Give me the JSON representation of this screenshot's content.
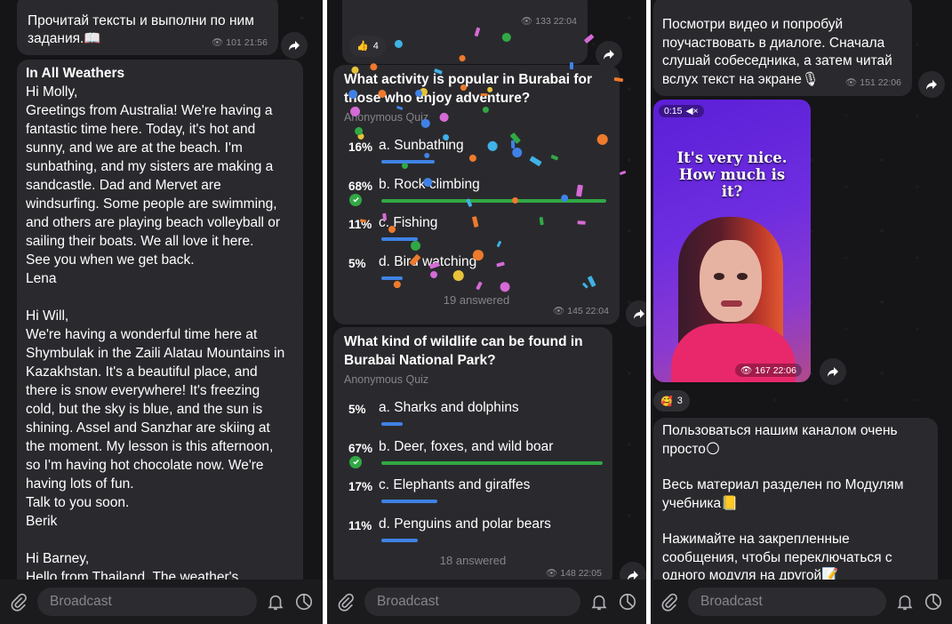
{
  "composer": {
    "placeholder": "Broadcast"
  },
  "panel1": {
    "intro_text": "Прочитай тексты и выполни по ним задания.📖",
    "intro_meta": "👁 101 21:56",
    "letters": [
      {
        "title": "In All Weathers",
        "lines": [
          "Hi Molly,",
          "Greetings from Australia! We're having a",
          "fantastic time here. Today, it's hot and",
          "sunny, and we are at the beach. I'm",
          "sunbathing, and my sisters are making a",
          "sandcastle. Dad and Mervet are",
          "windsurfing. Some people are swimming,",
          "and others are playing beach volleyball or",
          "sailing their boats. We all love it here.",
          "See you when we get back.",
          "Lena"
        ]
      },
      {
        "lines": [
          "Hi Will,",
          "We're having a wonderful time here at",
          "Shymbulak in the Zaili Alatau Mountains in",
          "Kazakhstan. It's a beautiful place, and",
          "there is snow everywhere! It's freezing",
          "cold, but the sky is blue, and the sun is",
          "shining. Assel and Sanzhar are skiing at",
          "the moment. My lesson is this afternoon,",
          "so I'm having hot chocolate now. We're",
          "having lots of fun.",
          "Talk to you soon.",
          "Berik"
        ]
      },
      {
        "lines": [
          "Hi Barney,",
          "Hello from Thailand. The weather's"
        ]
      }
    ]
  },
  "panel2": {
    "top_meta": "👁 133 22:04",
    "top_reaction": {
      "emoji": "👍",
      "count": "4"
    },
    "quiz1": {
      "question": "What activity is popular in Burabai for those who enjoy adventure?",
      "kind": "Anonymous Quiz",
      "options": [
        {
          "pct": "16%",
          "label": "a. Sunbathing",
          "fill": 0.16,
          "correct": false
        },
        {
          "pct": "68%",
          "label": "b. Rock climbing",
          "fill": 0.68,
          "correct": true
        },
        {
          "pct": "11%",
          "label": "c. Fishing",
          "fill": 0.11,
          "correct": false
        },
        {
          "pct": "5%",
          "label": "d. Bird watching",
          "fill": 0.05,
          "correct": false
        }
      ],
      "answered": "19 answered",
      "meta": "👁 145 22:04"
    },
    "quiz2": {
      "question": "What kind of wildlife can be found in Burabai National Park?",
      "kind": "Anonymous Quiz",
      "options": [
        {
          "pct": "5%",
          "label": "a. Sharks and dolphins",
          "fill": 0.05,
          "correct": false
        },
        {
          "pct": "67%",
          "label": "b. Deer, foxes, and wild boar",
          "fill": 0.67,
          "correct": true
        },
        {
          "pct": "17%",
          "label": "c. Elephants and giraffes",
          "fill": 0.17,
          "correct": false
        },
        {
          "pct": "11%",
          "label": "d. Penguins and polar bears",
          "fill": 0.11,
          "correct": false
        }
      ],
      "answered": "18 answered",
      "meta": "👁 148 22:05"
    }
  },
  "panel3": {
    "intro_text": "Посмотри видео и попробуй поучаствовать в диалоге. Сначала слушай собеседника, а затем читай вслух текст на экране🎙",
    "intro_meta": "👁 151 22:06",
    "video": {
      "time": "0:15",
      "caption": "It's very nice. How much is it?",
      "meta": "👁 167 22:06"
    },
    "reaction": {
      "emoji": "🥰",
      "count": "3"
    },
    "info_paragraphs": [
      "Пользоваться нашим каналом очень просто🌕",
      "Весь материал разделен по Модулям учебника📒",
      "Нажимайте на закрепленные сообщения, чтобы переключаться с одного модуля на другой📝"
    ]
  },
  "colors": {
    "background": "#151417",
    "bubble": "#2a2a2e",
    "accent_blue": "#3f82e6",
    "correct_green": "#31a845"
  }
}
